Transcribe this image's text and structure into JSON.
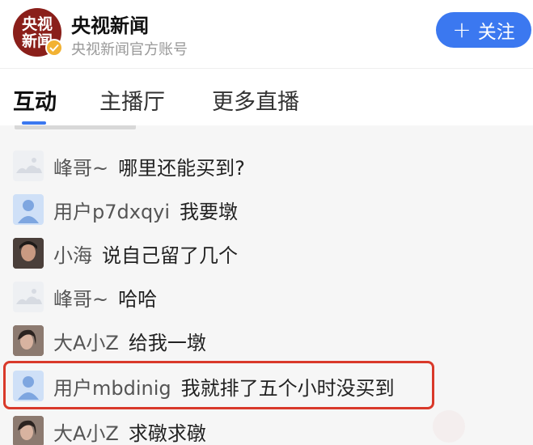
{
  "header": {
    "logo_text_line1": "央视",
    "logo_text_line2": "新闻",
    "account_name": "央视新闻",
    "account_subtitle": "央视新闻官方账号",
    "follow_button": {
      "icon": "plus-icon",
      "label": "关注"
    }
  },
  "tabs": [
    {
      "label": "互动",
      "active": true
    },
    {
      "label": "主播厅",
      "active": false
    },
    {
      "label": "更多直播",
      "active": false
    }
  ],
  "comments": [
    {
      "avatar": "cloud",
      "user": "峰哥~",
      "text": "哪里还能买到?"
    },
    {
      "avatar": "default",
      "user": "用户p7dxqyi",
      "text": "我要墩"
    },
    {
      "avatar": "photo",
      "user": "小海",
      "text": "说自己留了几个"
    },
    {
      "avatar": "cloud",
      "user": "峰哥~",
      "text": "哈哈"
    },
    {
      "avatar": "photo",
      "user": "大A小Z",
      "text": "给我一墩"
    },
    {
      "avatar": "default",
      "user": "用户mbdinig",
      "text": "我就排了五个小时没买到",
      "highlighted": true
    },
    {
      "avatar": "photo",
      "user": "大A小Z",
      "text": "求礅求礅"
    }
  ],
  "colors": {
    "accent": "#3b78f0",
    "highlight": "#d9392a"
  }
}
